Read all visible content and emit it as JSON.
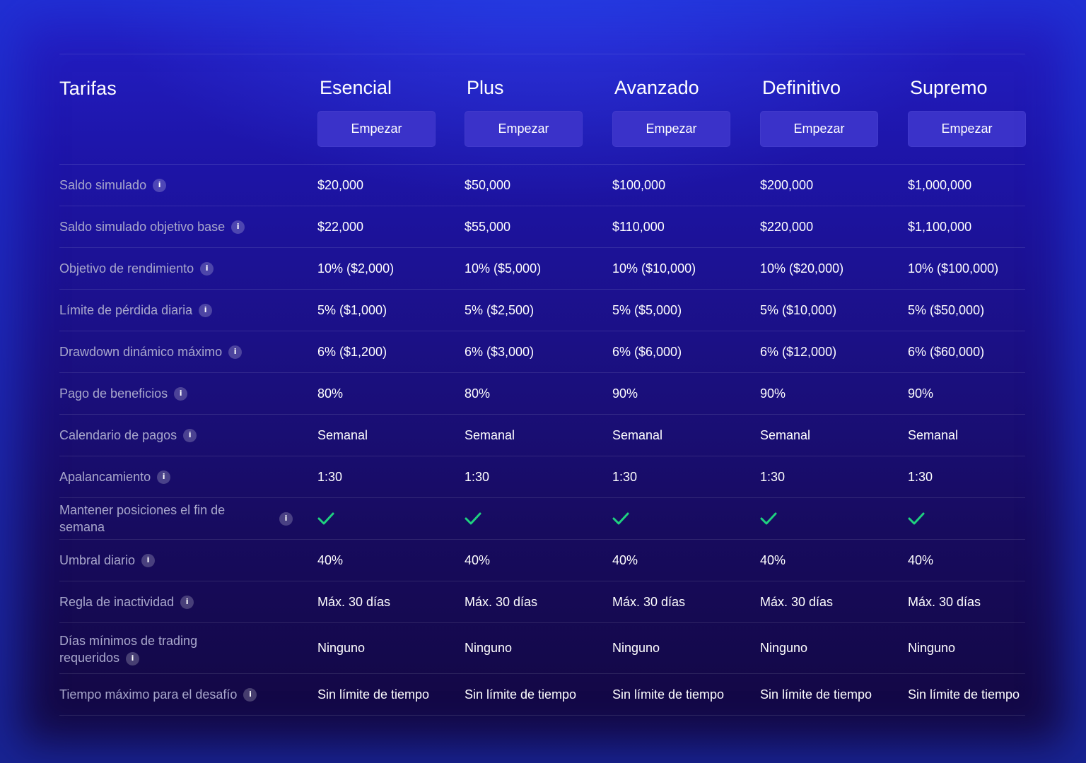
{
  "header": {
    "title": "Tarifas"
  },
  "plans": [
    {
      "name": "Esencial",
      "button_label": "Empezar"
    },
    {
      "name": "Plus",
      "button_label": "Empezar"
    },
    {
      "name": "Avanzado",
      "button_label": "Empezar"
    },
    {
      "name": "Definitivo",
      "button_label": "Empezar"
    },
    {
      "name": "Supremo",
      "button_label": "Empezar"
    }
  ],
  "rows": [
    {
      "label": "Saldo simulado",
      "values": [
        "$20,000",
        "$50,000",
        "$100,000",
        "$200,000",
        "$1,000,000"
      ]
    },
    {
      "label": "Saldo simulado objetivo base",
      "values": [
        "$22,000",
        "$55,000",
        "$110,000",
        "$220,000",
        "$1,100,000"
      ]
    },
    {
      "label": "Objetivo de rendimiento",
      "values": [
        "10% ($2,000)",
        "10% ($5,000)",
        "10% ($10,000)",
        "10% ($20,000)",
        "10% ($100,000)"
      ]
    },
    {
      "label": "Límite de pérdida diaria",
      "values": [
        "5% ($1,000)",
        "5% ($2,500)",
        "5% ($5,000)",
        "5% ($10,000)",
        "5% ($50,000)"
      ]
    },
    {
      "label": "Drawdown dinámico máximo",
      "values": [
        "6% ($1,200)",
        "6% ($3,000)",
        "6% ($6,000)",
        "6% ($12,000)",
        "6% ($60,000)"
      ]
    },
    {
      "label": "Pago de beneficios",
      "values": [
        "80%",
        "80%",
        "90%",
        "90%",
        "90%"
      ]
    },
    {
      "label": "Calendario de pagos",
      "values": [
        "Semanal",
        "Semanal",
        "Semanal",
        "Semanal",
        "Semanal"
      ]
    },
    {
      "label": "Apalancamiento",
      "values": [
        "1:30",
        "1:30",
        "1:30",
        "1:30",
        "1:30"
      ]
    },
    {
      "label": "Mantener posiciones el fin de semana",
      "check": true
    },
    {
      "label": "Umbral diario",
      "values": [
        "40%",
        "40%",
        "40%",
        "40%",
        "40%"
      ]
    },
    {
      "label": "Regla de inactividad",
      "values": [
        "Máx. 30 días",
        "Máx. 30 días",
        "Máx. 30 días",
        "Máx. 30 días",
        "Máx. 30 días"
      ]
    },
    {
      "label": "Días mínimos de trading requeridos",
      "values": [
        "Ninguno",
        "Ninguno",
        "Ninguno",
        "Ninguno",
        "Ninguno"
      ],
      "tall": true
    },
    {
      "label": "Tiempo máximo para el desafío",
      "values": [
        "Sin límite de tiempo",
        "Sin límite de tiempo",
        "Sin límite de tiempo",
        "Sin límite de tiempo",
        "Sin límite de tiempo"
      ]
    }
  ],
  "icons": {
    "info": "info-icon",
    "check": "check-icon"
  },
  "colors": {
    "check": "#1fd17f",
    "button": "#3a32c9",
    "label": "#a9a8cc"
  }
}
